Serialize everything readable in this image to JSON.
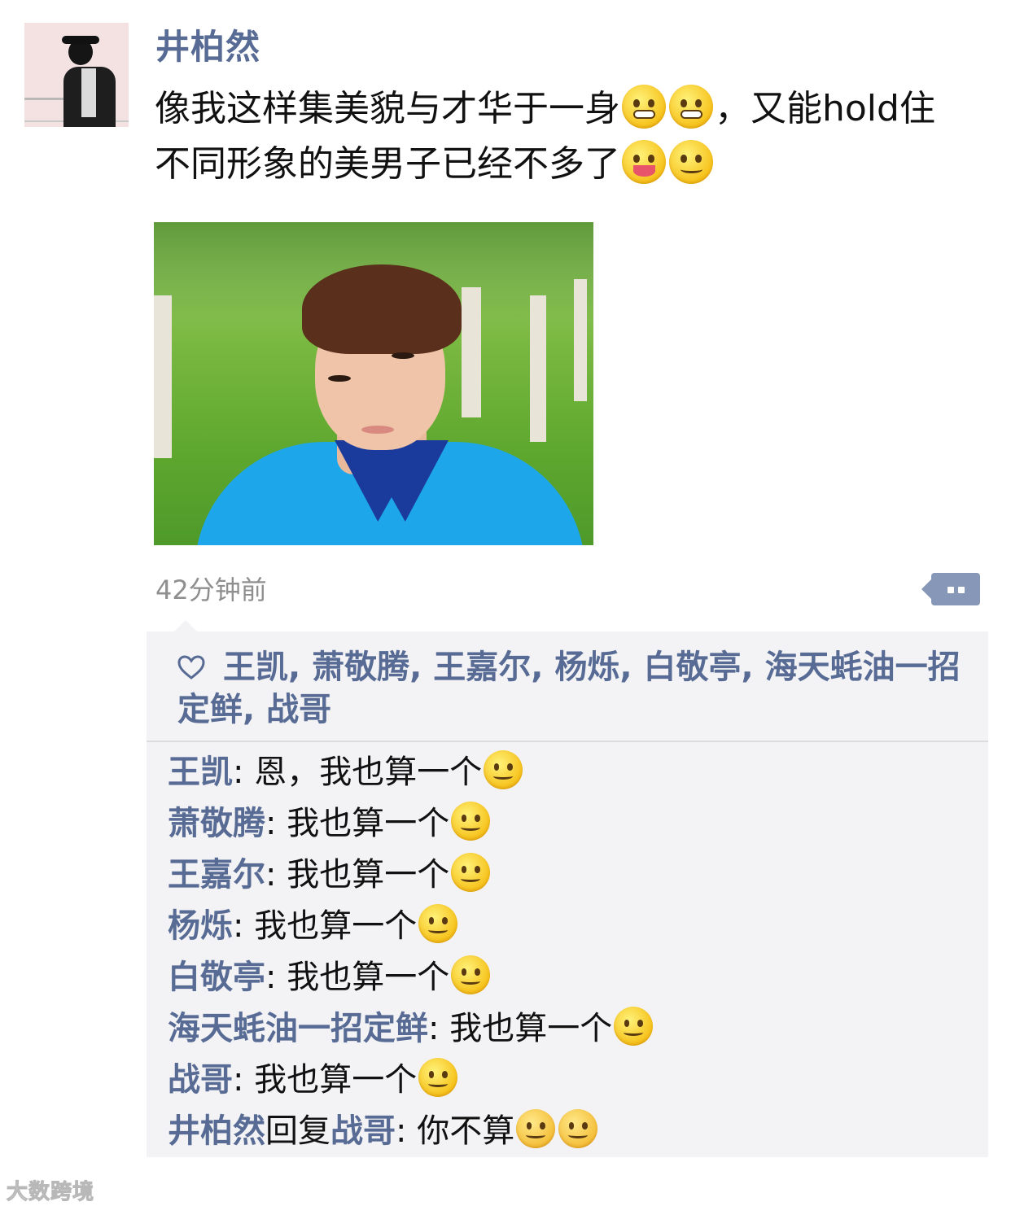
{
  "post": {
    "author": "井柏然",
    "text_part1": "像我这样集美貌与才华于一身",
    "text_part2": "，又能hold住不同形象的美男子已经不多了",
    "emojis_line1": [
      "grinning-emoji",
      "grinning-emoji"
    ],
    "emojis_line2": [
      "tongue-wink-emoji",
      "smirk-emoji"
    ],
    "time": "42分钟前"
  },
  "likes": {
    "names": [
      "王凯",
      "萧敬腾",
      "王嘉尔",
      "杨烁",
      "白敬亭",
      "海天蚝油一招定鲜",
      "战哥"
    ],
    "separator": ", "
  },
  "comments": [
    {
      "name": "王凯",
      "text": ": 恩，我也算一个",
      "emoji": "smile-emoji"
    },
    {
      "name": "萧敬腾",
      "text": ": 我也算一个",
      "emoji": "smile-emoji"
    },
    {
      "name": "王嘉尔",
      "text": ": 我也算一个",
      "emoji": "smile-emoji"
    },
    {
      "name": "杨烁",
      "text": ": 我也算一个",
      "emoji": "smile-emoji"
    },
    {
      "name": "白敬亭",
      "text": ": 我也算一个",
      "emoji": "smile-emoji"
    },
    {
      "name": "海天蚝油一招定鲜",
      "text": ": 我也算一个",
      "emoji": "smile-emoji"
    },
    {
      "name": "战哥",
      "text": ": 我也算一个",
      "emoji": "smile-emoji"
    }
  ],
  "reply": {
    "from": "井柏然",
    "word": "回复",
    "to": "战哥",
    "text": ": 你不算",
    "emojis": [
      "thinking-emoji",
      "thinking-emoji"
    ]
  },
  "watermark": "大数跨境",
  "colors": {
    "link": "#576b95",
    "comment_bg": "#f3f3f5",
    "time": "#8f8f8f"
  }
}
